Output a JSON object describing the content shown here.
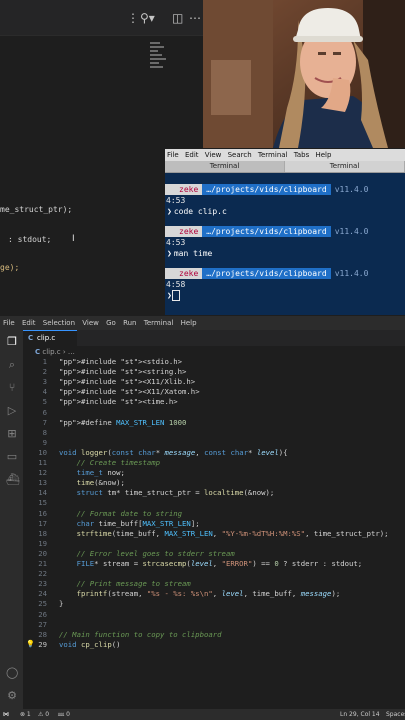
{
  "top_editor": {
    "code_fragments": [
      "me_struct_ptr);",
      ": stdout;",
      "ge);"
    ]
  },
  "terminal": {
    "menu": [
      "File",
      "Edit",
      "View",
      "Search",
      "Terminal",
      "Tabs",
      "Help"
    ],
    "tabs": [
      "Terminal",
      "Terminal"
    ],
    "prompts": [
      {
        "user": "zeke",
        "path": "…/projects/vids/clipboard",
        "version": "v11.4.0",
        "time": "4:53",
        "command": "code clip.c"
      },
      {
        "user": "zeke",
        "path": "…/projects/vids/clipboard",
        "version": "v11.4.0",
        "time": "4:53",
        "command": "man time"
      },
      {
        "user": "zeke",
        "path": "…/projects/vids/clipboard",
        "version": "v11.4.0",
        "time": "4:58",
        "command": ""
      }
    ],
    "colors": {
      "background": "#0b2a50",
      "path_segment": "#1f6fc7"
    }
  },
  "vscode": {
    "menu": [
      "File",
      "Edit",
      "Selection",
      "View",
      "Go",
      "Run",
      "Terminal",
      "Help"
    ],
    "active_tab": "clip.c",
    "breadcrumb": "clip.c › …",
    "code_lines": [
      {
        "n": "1",
        "text": "#include <stdio.h>"
      },
      {
        "n": "2",
        "text": "#include <string.h>"
      },
      {
        "n": "3",
        "text": "#include <X11/Xlib.h>"
      },
      {
        "n": "4",
        "text": "#include <X11/Xatom.h>"
      },
      {
        "n": "5",
        "text": "#include <time.h>"
      },
      {
        "n": "6",
        "text": ""
      },
      {
        "n": "7",
        "text": "#define MAX_STR_LEN 1000"
      },
      {
        "n": "8",
        "text": ""
      },
      {
        "n": "9",
        "text": ""
      },
      {
        "n": "10",
        "text": "void logger(const char* message, const char* level){"
      },
      {
        "n": "11",
        "text": "    // Create timestamp"
      },
      {
        "n": "12",
        "text": "    time_t now;"
      },
      {
        "n": "13",
        "text": "    time(&now);"
      },
      {
        "n": "14",
        "text": "    struct tm* time_struct_ptr = localtime(&now);"
      },
      {
        "n": "15",
        "text": ""
      },
      {
        "n": "16",
        "text": "    // Format date to string"
      },
      {
        "n": "17",
        "text": "    char time_buff[MAX_STR_LEN];"
      },
      {
        "n": "18",
        "text": "    strftime(time_buff, MAX_STR_LEN, \"%Y-%m-%dT%H:%M:%S\", time_struct_ptr);"
      },
      {
        "n": "19",
        "text": ""
      },
      {
        "n": "20",
        "text": "    // Error level goes to stderr stream"
      },
      {
        "n": "21",
        "text": "    FILE* stream = strcasecmp(level, \"ERROR\") == 0 ? stderr : stdout;"
      },
      {
        "n": "22",
        "text": ""
      },
      {
        "n": "23",
        "text": "    // Print message to stream"
      },
      {
        "n": "24",
        "text": "    fprintf(stream, \"%s - %s: %s\\n\", level, time_buff, message);"
      },
      {
        "n": "25",
        "text": "}"
      },
      {
        "n": "26",
        "text": ""
      },
      {
        "n": "27",
        "text": ""
      },
      {
        "n": "28",
        "text": "// Main function to copy to clipboard"
      },
      {
        "n": "29",
        "text": "void cp_clip()"
      }
    ],
    "status": {
      "errors": "⊗ 1",
      "warnings": "⚠ 0",
      "ports": "⅏ 0",
      "cursor": "Ln 29, Col 14",
      "spaces": "Spaces"
    }
  }
}
